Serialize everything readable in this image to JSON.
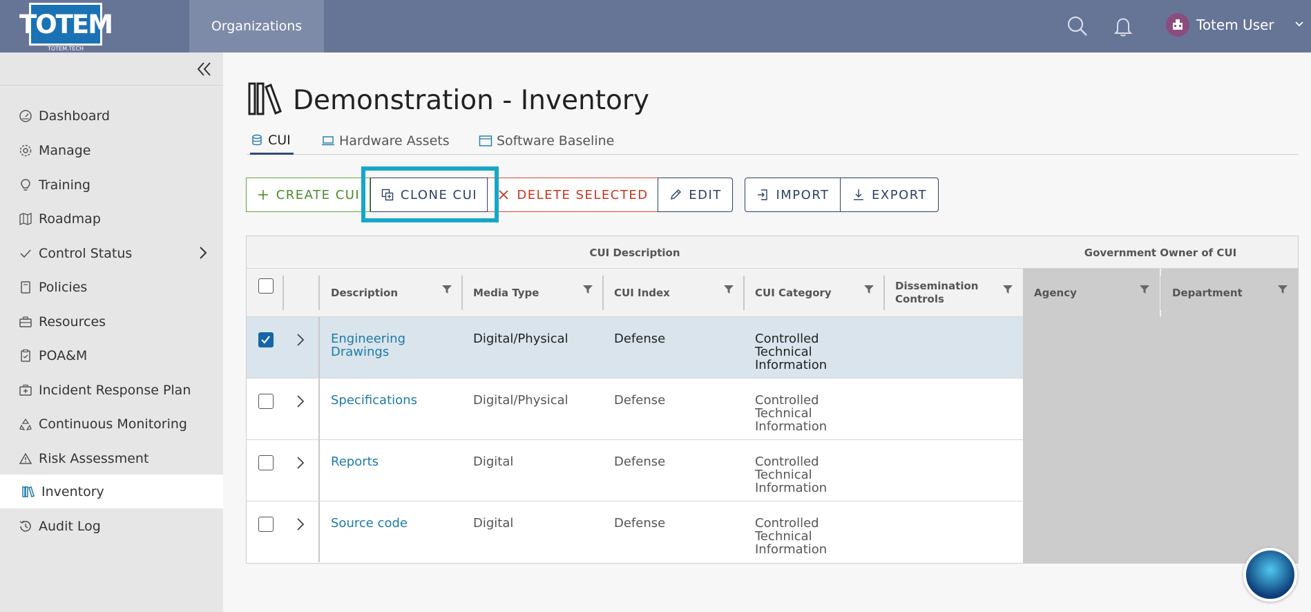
{
  "header": {
    "logo_text": "TOTEM",
    "logo_sub": "TOTEM.TECH",
    "nav_item": "Organizations",
    "user_name": "Totem User"
  },
  "sidebar": {
    "items": [
      {
        "label": "Dashboard",
        "icon": "gauge-icon"
      },
      {
        "label": "Manage",
        "icon": "gear-icon"
      },
      {
        "label": "Training",
        "icon": "lightbulb-icon"
      },
      {
        "label": "Roadmap",
        "icon": "map-icon"
      },
      {
        "label": "Control Status",
        "icon": "check-icon"
      },
      {
        "label": "Policies",
        "icon": "document-icon"
      },
      {
        "label": "Resources",
        "icon": "toolbox-icon"
      },
      {
        "label": "POA&M",
        "icon": "clipboard-icon"
      },
      {
        "label": "Incident Response Plan",
        "icon": "first-aid-icon"
      },
      {
        "label": "Continuous Monitoring",
        "icon": "recycle-icon"
      },
      {
        "label": "Risk Assessment",
        "icon": "warning-icon"
      },
      {
        "label": "Inventory",
        "icon": "books-icon"
      },
      {
        "label": "Audit Log",
        "icon": "history-icon"
      }
    ],
    "active": "Inventory"
  },
  "page": {
    "title": "Demonstration - Inventory"
  },
  "tabs": [
    {
      "label": "CUI",
      "active": true
    },
    {
      "label": "Hardware Assets",
      "active": false
    },
    {
      "label": "Software Baseline",
      "active": false
    }
  ],
  "toolbar": {
    "create": "CREATE CUI",
    "clone": "CLONE CUI",
    "delete": "DELETE SELECTED",
    "edit": "EDIT",
    "import": "IMPORT",
    "export": "EXPORT"
  },
  "table": {
    "groups": [
      "CUI Description",
      "Government Owner of CUI"
    ],
    "columns": [
      "Description",
      "Media Type",
      "CUI Index",
      "CUI Category",
      "Dissemination Controls",
      "Agency",
      "Department"
    ],
    "rows": [
      {
        "selected": true,
        "description": "Engineering Drawings",
        "media_type": "Digital/Physical",
        "cui_index": "Defense",
        "cui_category": "Controlled Technical Information",
        "dissemination": "",
        "agency": "",
        "department": ""
      },
      {
        "selected": false,
        "description": "Specifications",
        "media_type": "Digital/Physical",
        "cui_index": "Defense",
        "cui_category": "Controlled Technical Information",
        "dissemination": "",
        "agency": "",
        "department": ""
      },
      {
        "selected": false,
        "description": "Reports",
        "media_type": "Digital",
        "cui_index": "Defense",
        "cui_category": "Controlled Technical Information",
        "dissemination": "",
        "agency": "",
        "department": ""
      },
      {
        "selected": false,
        "description": "Source code",
        "media_type": "Digital",
        "cui_index": "Defense",
        "cui_category": "Controlled Technical Information",
        "dissemination": "",
        "agency": "",
        "department": ""
      }
    ]
  },
  "colors": {
    "header": "#667496",
    "sidebar": "#e6e6e6",
    "create": "#4a8a2a",
    "delete": "#c6361e",
    "primary": "#2d3f66",
    "highlight": "#16a7c8",
    "link": "#1e7aa8",
    "selected_row": "#d9e4ec"
  }
}
